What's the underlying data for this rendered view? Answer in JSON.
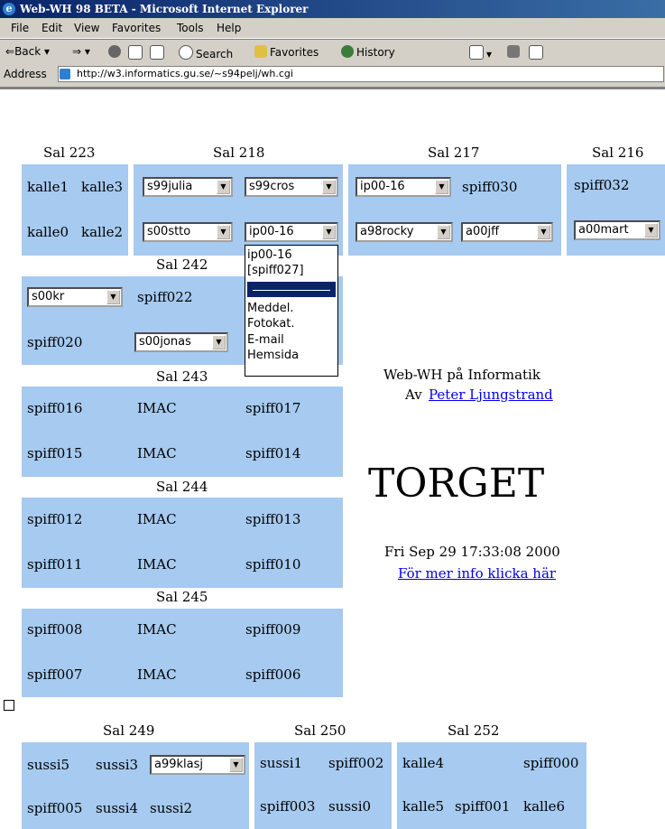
{
  "window": {
    "title": "Web-WH 98 BETA - Microsoft Internet Explorer",
    "menus": [
      "File",
      "Edit",
      "View",
      "Favorites",
      "Tools",
      "Help"
    ],
    "toolbar": {
      "back": "Back",
      "search": "Search",
      "favorites": "Favorites",
      "history": "History"
    },
    "address_label": "Address",
    "url": "http://w3.informatics.gu.se/~s94pelj/wh.cgi"
  },
  "rooms": {
    "sal223": {
      "name": "Sal 223",
      "row1": [
        "kalle1",
        "kalle3"
      ],
      "row2": [
        "kalle0",
        "kalle2"
      ]
    },
    "sal218": {
      "name": "Sal 218",
      "selects": [
        "s99julia",
        "s99cros",
        "s00stto",
        "ip00-16"
      ]
    },
    "sal217": {
      "name": "Sal 217",
      "select1": "ip00-16",
      "text1": "spiff030",
      "select2": "a98rocky",
      "select3": "a00jff"
    },
    "sal216": {
      "name": "Sal 216",
      "text1": "spiff032",
      "select1": "a00mart"
    },
    "sal242": {
      "name": "Sal 242",
      "select1": "s00kr",
      "text1": "spiff022",
      "text2": "spiff020",
      "select2": "s00jonas"
    },
    "sal243": {
      "name": "Sal 243",
      "rows": [
        [
          "spiff016",
          "IMAC",
          "spiff017"
        ],
        [
          "spiff015",
          "IMAC",
          "spiff014"
        ]
      ]
    },
    "sal244": {
      "name": "Sal 244",
      "rows": [
        [
          "spiff012",
          "IMAC",
          "spiff013"
        ],
        [
          "spiff011",
          "IMAC",
          "spiff010"
        ]
      ]
    },
    "sal245": {
      "name": "Sal 245",
      "rows": [
        [
          "spiff008",
          "IMAC",
          "spiff009"
        ],
        [
          "spiff007",
          "IMAC",
          "spiff006"
        ]
      ]
    },
    "sal249": {
      "name": "Sal 249",
      "row1": [
        "sussi5",
        "sussi3"
      ],
      "select1": "a99klasj",
      "row2": [
        "spiff005",
        "sussi4",
        "sussi2"
      ]
    },
    "sal250": {
      "name": "Sal 250",
      "row1": [
        "sussi1",
        "spiff002"
      ],
      "row2": [
        "spiff003",
        "sussi0"
      ]
    },
    "sal252": {
      "name": "Sal 252",
      "row1": [
        "kalle4",
        "spiff000"
      ],
      "row2": [
        "kalle5",
        "spiff001",
        "kalle6"
      ]
    }
  },
  "dropdown_options": [
    "ip00-16",
    "[spiff027]",
    "────",
    "Meddel.",
    "Fotokat.",
    "E-mail",
    "Hemsida"
  ],
  "info": {
    "line1": "Web-WH på Informatik",
    "by": "Av",
    "author": "Peter Ljungstrand",
    "torget": "TORGET",
    "date": "Fri Sep 29 17:33:08 2000",
    "more": "För mer info klicka här"
  }
}
